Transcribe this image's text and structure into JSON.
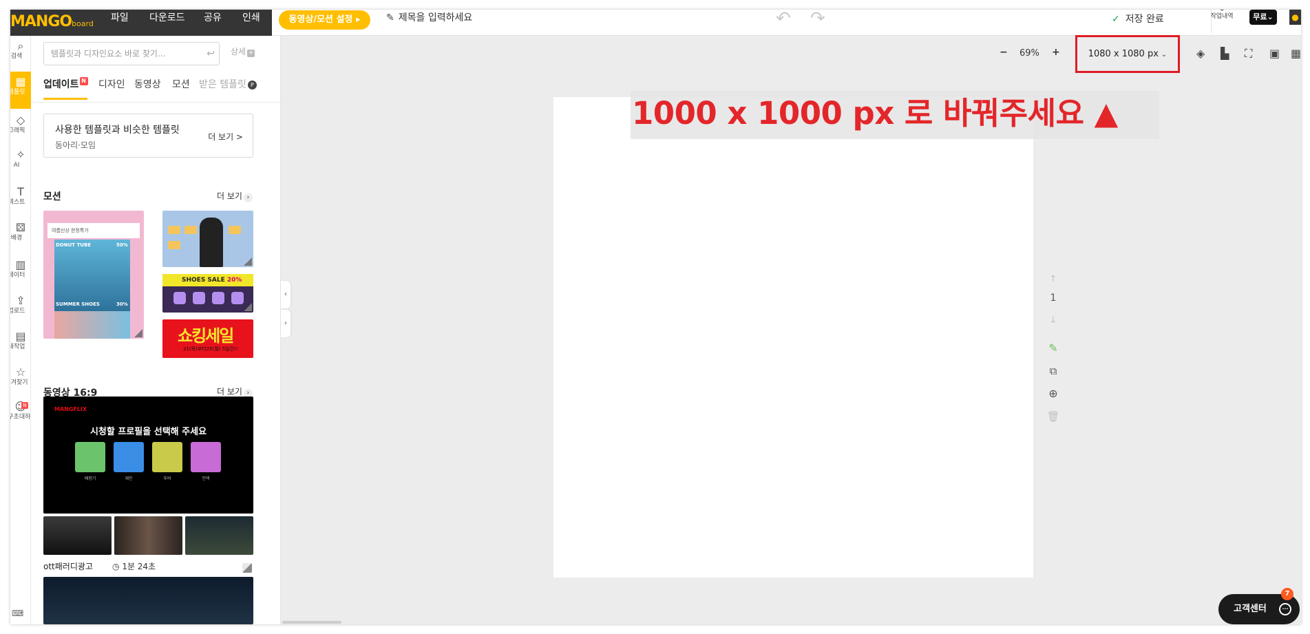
{
  "app": {
    "logo_main": "MANGO",
    "logo_sub": "board"
  },
  "menu": {
    "file": "파일",
    "download": "다운로드",
    "share": "공유",
    "print": "인쇄"
  },
  "topbar": {
    "video_setting": "동영상/모션 설정 ▸",
    "title_placeholder": "제목을 입력하세요",
    "save_status": "저장 완료",
    "history_label": "작업내역",
    "plan_label": "무료⌄"
  },
  "rail": [
    {
      "icon": "search-icon",
      "glyph": "⌕",
      "label": "검색"
    },
    {
      "icon": "template-icon",
      "glyph": "▦",
      "label": "템플릿",
      "active": true
    },
    {
      "icon": "graphic-icon",
      "glyph": "◇",
      "label": "그래픽"
    },
    {
      "icon": "ai-icon",
      "glyph": "✧",
      "label": "AI"
    },
    {
      "icon": "text-icon",
      "glyph": "T",
      "label": "텍스트"
    },
    {
      "icon": "background-icon",
      "glyph": "⚄",
      "label": "배경"
    },
    {
      "icon": "data-icon",
      "glyph": "▥",
      "label": "데이터"
    },
    {
      "icon": "upload-icon",
      "glyph": "⇪",
      "label": "업로드"
    },
    {
      "icon": "my-work-icon",
      "glyph": "▤",
      "label": "내작업"
    },
    {
      "icon": "favorite-icon",
      "glyph": "☆",
      "label": "즐겨찾기"
    },
    {
      "icon": "friend-icon",
      "glyph": "☺",
      "label": "친구초대하기"
    }
  ],
  "panel": {
    "search_placeholder": "템플릿과 디자인요소 바로 찾기...",
    "detail_label": "상세",
    "tabs": [
      "업데이트",
      "디자인",
      "동영상",
      "모션",
      "받은 템플릿"
    ],
    "similar": {
      "title": "사용한 템플릿과 비슷한 템플릿",
      "subtitle": "동아리·모임",
      "more": "더 보기 >"
    },
    "motion_section": {
      "title": "모션",
      "more": "더 보기"
    },
    "video_section": {
      "title": "동영상 16:9",
      "more": "더 보기"
    },
    "thumbs": {
      "summer_header": "여름신상 한정특가",
      "donut_tube": "DONUT TUBE",
      "donut_pct": "50%",
      "summer_shoes": "SUMMER SHOES",
      "summer_pct": "30%",
      "shoes_sale": "SHOES SALE",
      "shoes_pct": "20%",
      "king_sale": "쇼킹세일",
      "king_sub": "21(목)부터25(월) 5일간!!",
      "netflix_brand": "MANGFLIX",
      "netflix_headline": "시청할 프로필을 선택해 주세요",
      "netflix_profiles": [
        "배향기",
        "재민",
        "뚜비",
        "인덱"
      ]
    },
    "video_item": {
      "name": "ott패러디광고",
      "duration": "1분 24초"
    }
  },
  "toolbar": {
    "zoom_minus": "−",
    "zoom_value": "69%",
    "zoom_plus": "+",
    "size_value": "1080 x 1080 px"
  },
  "annotation": {
    "text": "1000 x 1000 px 로 바꿔주세요 ▲",
    "color": "#e3262a"
  },
  "page_controls": {
    "page_number": "1"
  },
  "help": {
    "label": "고객센터",
    "badge": "7"
  },
  "colors": {
    "brand": "#ffbe00",
    "dark_bar": "#353535",
    "highlight_border": "#e01b24"
  }
}
